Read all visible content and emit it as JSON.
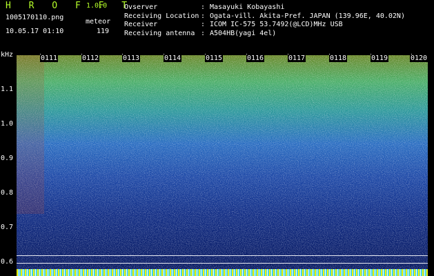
{
  "app": {
    "title": "H R O F F T",
    "version": "1.0.0"
  },
  "capture": {
    "filename": "1005170110.png",
    "datetime": "10.05.17 01:10",
    "type": "meteor",
    "count": "119"
  },
  "info": [
    {
      "key": "Ovserver",
      "value": "Masayuki Kobayashi"
    },
    {
      "key": "Receiving Location",
      "value": "Ogata-vill. Akita-Pref. JAPAN (139.96E, 40.02N)"
    },
    {
      "key": "Receiver",
      "value": "ICOM IC-575 53.7492(@LCD)MHz USB"
    },
    {
      "key": "Receiving antenna",
      "value": "A504HB(yagi 4el)"
    }
  ],
  "axis": {
    "unit": "kHz",
    "y_ticks": [
      "1.1",
      "1.0",
      "0.9",
      "0.8",
      "0.7",
      "0.6"
    ],
    "x_ticks": [
      "0111",
      "0112",
      "0113",
      "0114",
      "0115",
      "0116",
      "0117",
      "0118",
      "0119",
      "0120"
    ]
  },
  "colors": {
    "title": "#b6ff2a",
    "background": "#000000",
    "text": "#ffffff"
  }
}
